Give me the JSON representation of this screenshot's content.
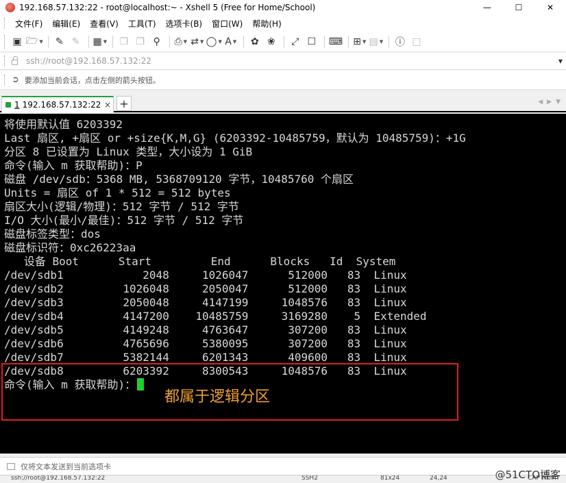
{
  "window": {
    "title": "192.168.57.132:22 - root@localhost:~ - Xshell 5 (Free for Home/School)",
    "minimize": "—",
    "maximize": "☐",
    "close": "✕"
  },
  "menu": {
    "items": [
      "文件(F)",
      "编辑(E)",
      "查看(V)",
      "工具(T)",
      "选项卡(B)",
      "窗口(W)",
      "帮助(H)"
    ]
  },
  "address": {
    "text": "ssh://root@192.168.57.132:22"
  },
  "hint": {
    "text": "要添加当前会话，点击左侧的箭头按钮。"
  },
  "tab": {
    "number": "1",
    "label": "192.168.57.132:22",
    "close": "×",
    "add": "+"
  },
  "terminal": {
    "lines": [
      "将使用默认值 6203392",
      "Last 扇区, +扇区 or +size{K,M,G} (6203392-10485759，默认为 10485759)：+1G",
      "分区 8 已设置为 Linux 类型，大小设为 1 GiB",
      "",
      "命令(输入 m 获取帮助)：P",
      "",
      "磁盘 /dev/sdb：5368 MB, 5368709120 字节，10485760 个扇区",
      "Units = 扇区 of 1 * 512 = 512 bytes",
      "扇区大小(逻辑/物理)：512 字节 / 512 字节",
      "I/O 大小(最小/最佳)：512 字节 / 512 字节",
      "磁盘标签类型：dos",
      "磁盘标识符：0xc26223aa",
      "",
      "   设备 Boot      Start         End      Blocks   Id  System",
      "/dev/sdb1            2048     1026047      512000   83  Linux",
      "/dev/sdb2         1026048     2050047      512000   83  Linux",
      "/dev/sdb3         2050048     4147199     1048576   83  Linux",
      "/dev/sdb4         4147200    10485759     3169280    5  Extended",
      "/dev/sdb5         4149248     4763647      307200   83  Linux",
      "/dev/sdb6         4765696     5380095      307200   83  Linux",
      "/dev/sdb7         5382144     6201343      409600   83  Linux",
      "/dev/sdb8         6203392     8300543     1048576   83  Linux",
      ""
    ],
    "prompt": "命令(输入 m 获取帮助)："
  },
  "annotation": {
    "text": "都属于逻辑分区",
    "color": "#f0a030",
    "box_color": "#e02020"
  },
  "sendbar": {
    "placeholder": "仅将文本发送到当前选项卡"
  },
  "statusbar": {
    "connection": "ssh://root@192.168.57.132:22",
    "protocol": "SSH2",
    "size": "81x24",
    "position": "24,24",
    "num": "CAP NUM"
  },
  "watermark": "@51CTO博客",
  "colors": {
    "terminal_bg": "#000000",
    "terminal_fg": "#d8d8d8",
    "cursor": "#1fd02c",
    "tab_accent": "#1fa33a"
  }
}
